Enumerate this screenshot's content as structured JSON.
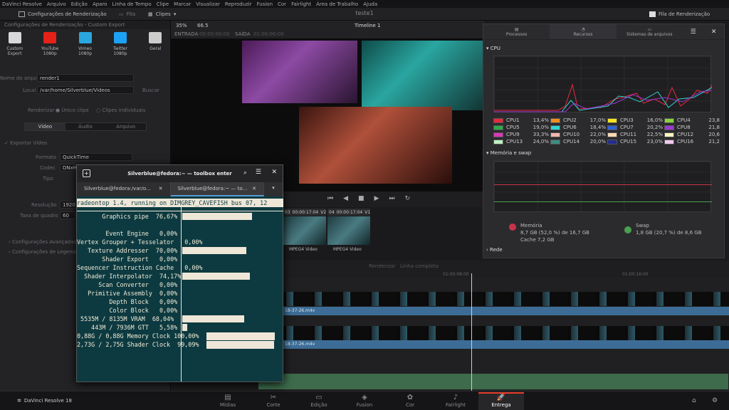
{
  "menubar": [
    "DaVinci Resolve",
    "Arquivo",
    "Edição",
    "Aparo",
    "Linha de Tempo",
    "Clipe",
    "Marcar",
    "Visualizar",
    "Reproduzir",
    "Fusion",
    "Cor",
    "Fairlight",
    "Área de Trabalho",
    "Ajuda"
  ],
  "toolbar": {
    "render_settings": "Configurações de Renderização",
    "fita": "Fita",
    "clipes": "Clipes",
    "project_title": "teste1",
    "render_queue": "Fila de Renderização"
  },
  "left": {
    "header": "Configurações de Renderização - Custom Export",
    "presets": [
      {
        "label": "Custom Export",
        "color": "#d8d8d8"
      },
      {
        "label": "YouTube 1080p",
        "color": "#e62117"
      },
      {
        "label": "Vimeo 1080p",
        "color": "#2aa7de"
      },
      {
        "label": "Twitter 1080p",
        "color": "#1da1f2"
      },
      {
        "label": "Geral",
        "color": "#cccccc"
      }
    ],
    "name_label": "Nome do arquivo",
    "name_value": "render1",
    "loc_label": "Local",
    "loc_value": "/var/home/Silverblue/Videos",
    "browse": "Buscar",
    "render_label": "Renderizar",
    "render_single": "Único clipe",
    "render_multi": "Clipes individuais",
    "tabs": [
      "Vídeo",
      "Áudio",
      "Arquivo"
    ],
    "export_video": "Exportar Vídeo",
    "format_label": "Formato",
    "format_value": "QuickTime",
    "codec_label": "Codec",
    "codec_value": "DNxHR",
    "type_label": "Tipo",
    "res_label": "Resolução",
    "res_value": "1920",
    "fps_label": "Taxa de quadro",
    "fps_value": "60",
    "advanced": "Configurações Avançadas",
    "subtitles": "Configurações de Legenda"
  },
  "viewer": {
    "zoom": "35%",
    "tc": "66.5",
    "timeline_name": "Timeline 1",
    "entrada": "ENTRADA",
    "entrada_val": "00:00:00:00",
    "saida": "SAÍDA",
    "saida_val": "01:00:00:00"
  },
  "clips": [
    {
      "num": "03",
      "tc": "00:00:17:04",
      "track": "V2",
      "label": "MPEG4 Video"
    },
    {
      "num": "04",
      "tc": "00:00:17:04",
      "track": "V1",
      "label": "MPEG4 Video"
    }
  ],
  "monitor": {
    "tabs": [
      "Processos",
      "Recursos",
      "Sistemas de arquivos"
    ],
    "cpu_title": "CPU",
    "cpus": [
      {
        "name": "CPU1",
        "val": "13,4%",
        "color": "#e8293c"
      },
      {
        "name": "CPU2",
        "val": "17,0%",
        "color": "#f08f1f"
      },
      {
        "name": "CPU3",
        "val": "16,0%",
        "color": "#f6e51d"
      },
      {
        "name": "CPU4",
        "val": "23,8",
        "color": "#8bd43c"
      },
      {
        "name": "CPU5",
        "val": "19,0%",
        "color": "#2faa4a"
      },
      {
        "name": "CPU6",
        "val": "18,4%",
        "color": "#2fd5d2"
      },
      {
        "name": "CPU7",
        "val": "20,2%",
        "color": "#2b62d6"
      },
      {
        "name": "CPU8",
        "val": "21,8",
        "color": "#9b38d6"
      },
      {
        "name": "CPU9",
        "val": "33,3%",
        "color": "#d838b6"
      },
      {
        "name": "CPU10",
        "val": "22,0%",
        "color": "#f3b7b0"
      },
      {
        "name": "CPU11",
        "val": "22,5%",
        "color": "#f7d9b5"
      },
      {
        "name": "CPU12",
        "val": "20,6",
        "color": "#f9f4c2"
      },
      {
        "name": "CPU13",
        "val": "24,0%",
        "color": "#bff0c0"
      },
      {
        "name": "CPU14",
        "val": "20,0%",
        "color": "#3f8a82"
      },
      {
        "name": "CPU15",
        "val": "23,0%",
        "color": "#232d8c"
      },
      {
        "name": "CPU16",
        "val": "21,2",
        "color": "#f0c9f0"
      }
    ],
    "mem_title": "Memória e swap",
    "mem_label": "Memória",
    "mem_val": "8,7 GB (52,0 %) de 16,7 GB",
    "cache": "Cache 7,2 GB",
    "swap_label": "Swap",
    "swap_val": "1,8 GB (20,7 %) de 8,6 GB",
    "net": "Rede"
  },
  "timeline": {
    "render_label": "Renderizar",
    "render_mode": "Linha completa",
    "tc1": "01:00:08:00",
    "tc2": "01:00:16:00",
    "clip_name": "18-37-26.m4v",
    "clip_name2": "18-37-26.m4v"
  },
  "pages": [
    {
      "label": "Mídias",
      "icon": "▤"
    },
    {
      "label": "Corte",
      "icon": "✂"
    },
    {
      "label": "Edição",
      "icon": "▭"
    },
    {
      "label": "Fusion",
      "icon": "◈"
    },
    {
      "label": "Cor",
      "icon": "✿"
    },
    {
      "label": "Fairlight",
      "icon": "♪"
    },
    {
      "label": "Entrega",
      "icon": "🚀"
    }
  ],
  "app_name": "DaVinci Resolve 18",
  "terminal": {
    "title": "Silverblue@fedora:~ — toolbox enter",
    "tab1": "Silverblue@fedora:/var/o...",
    "tab2": "Silverblue@fedora:~ — to...",
    "status": "radeontop 1.4, running on DIMGREY_CAVEFISH bus 07, 12",
    "rows": [
      {
        "label": "       Graphics pipe  76,67%",
        "pct": 76.67
      },
      {
        "label": "        Event Engine   0,00%",
        "pct": 0
      },
      {
        "label": "Vertex Grouper + Tesselator   0,00%",
        "pct": 0
      },
      {
        "label": "   Texture Addresser  70,00%",
        "pct": 70.0
      },
      {
        "label": "       Shader Export   0,00%",
        "pct": 0
      },
      {
        "label": "Sequencer Instruction Cache   0,00%",
        "pct": 0
      },
      {
        "label": "  Shader Interpolator  74,17%",
        "pct": 74.17
      },
      {
        "label": "      Scan Converter   0,00%",
        "pct": 0
      },
      {
        "label": "   Primitive Assembly  0,00%",
        "pct": 0
      },
      {
        "label": "         Depth Block   0,00%",
        "pct": 0
      },
      {
        "label": "         Color Block   0,00%",
        "pct": 0
      },
      {
        "label": " 5535M / 8135M VRAM  68,04%",
        "pct": 68.04
      },
      {
        "label": "    443M / 7936M GTT   5,58%",
        "pct": 5.58
      },
      {
        "label": "0,88G / 0,88G Memory Clock 100,00%",
        "pct": 100
      },
      {
        "label": "2,73G / 2,75G Shader Clock  99,09%",
        "pct": 99.09
      }
    ]
  }
}
